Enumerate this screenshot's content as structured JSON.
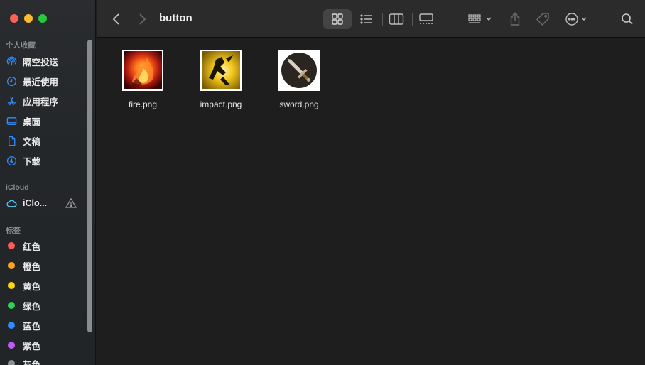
{
  "window": {
    "title": "button"
  },
  "sidebar": {
    "favorites_title": "个人收藏",
    "favorites": [
      {
        "label": "隔空投送",
        "icon": "airdrop-icon"
      },
      {
        "label": "最近使用",
        "icon": "clock-icon"
      },
      {
        "label": "应用程序",
        "icon": "applications-icon"
      },
      {
        "label": "桌面",
        "icon": "desktop-icon"
      },
      {
        "label": "文稿",
        "icon": "document-icon"
      },
      {
        "label": "下载",
        "icon": "download-icon"
      }
    ],
    "icloud_title": "iCloud",
    "icloud_items": [
      {
        "label": "iClo...",
        "icon": "cloud-icon"
      }
    ],
    "tags_title": "标签",
    "tags": [
      {
        "label": "红色",
        "color": "#ff5b5b"
      },
      {
        "label": "橙色",
        "color": "#ffa31a"
      },
      {
        "label": "黄色",
        "color": "#ffd60a"
      },
      {
        "label": "绿色",
        "color": "#30d158"
      },
      {
        "label": "蓝色",
        "color": "#2f8cff"
      },
      {
        "label": "紫色",
        "color": "#bf5af2"
      },
      {
        "label": "灰色",
        "color": "#8e8e93"
      }
    ]
  },
  "toolbar": {
    "icons": [
      "back-icon",
      "forward-icon",
      "icon-view-icon",
      "list-view-icon",
      "column-view-icon",
      "gallery-view-icon",
      "group-icon",
      "share-icon",
      "tag-icon",
      "more-icon",
      "search-icon"
    ]
  },
  "files": [
    {
      "name": "fire.png"
    },
    {
      "name": "impact.png"
    },
    {
      "name": "sword.png"
    }
  ]
}
